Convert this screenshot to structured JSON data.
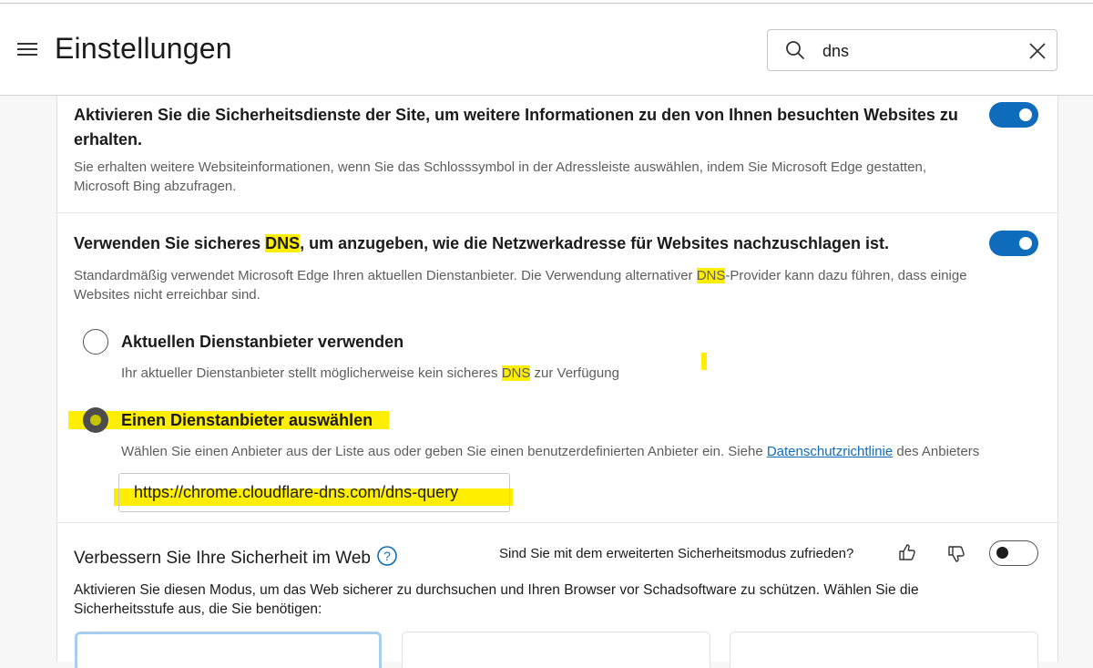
{
  "header": {
    "title": "Einstellungen",
    "search_value": "dns"
  },
  "site_security": {
    "heading_line1": "Aktivieren Sie die Sicherheitsdienste der Site, um weitere Informationen zu den von Ihnen besuchten Websites zu",
    "heading_line2": "erhalten.",
    "desc_line1": "Sie erhalten weitere Websiteinformationen, wenn Sie das Schlosssymbol in der Adressleiste auswählen, indem Sie Microsoft Edge gestatten,",
    "desc_line2": "Microsoft Bing abzufragen.",
    "toggle_on": true
  },
  "secure_dns": {
    "heading_pre": "Verwenden Sie sicheres ",
    "heading_hl": "DNS",
    "heading_post": ", um anzugeben, wie die Netzwerkadresse für Websites nachzuschlagen ist.",
    "desc1_pre": "Standardmäßig verwendet Microsoft Edge Ihren aktuellen Dienstanbieter. Die Verwendung alternativer ",
    "desc1_hl": "DNS",
    "desc1_post": "-Provider kann dazu führen, dass einige",
    "desc2": "Websites nicht erreichbar sind.",
    "toggle_on": true,
    "option_current": {
      "label": "Aktuellen Dienstanbieter verwenden",
      "desc_pre": "Ihr aktueller Dienstanbieter stellt möglicherweise kein sicheres ",
      "desc_hl": "DNS",
      "desc_post": " zur Verfügung"
    },
    "option_choose": {
      "label": "Einen Dienstanbieter auswählen",
      "desc_pre": "Wählen Sie einen Anbieter aus der Liste aus oder geben Sie einen benutzerdefinierten Anbieter ein. Siehe ",
      "desc_link": "Datenschutzrichtlinie",
      "desc_post": " des Anbieters",
      "provider_url": "https://chrome.cloudflare-dns.com/dns-query"
    },
    "selected_option": "choose"
  },
  "improve_security": {
    "heading": "Verbessern Sie Ihre Sicherheit im Web",
    "feedback_question": "Sind Sie mit dem erweiterten Sicherheitsmodus zufrieden?",
    "toggle_on": false,
    "desc_line1": "Aktivieren Sie diesen Modus, um das Web sicherer zu durchsuchen und Ihren Browser vor Schadsoftware zu schützen. Wählen Sie die",
    "desc_line2": "Sicherheitsstufe aus, die Sie benötigen:"
  },
  "colors": {
    "accent": "#0f6cbd",
    "highlight": "#ffee00"
  }
}
